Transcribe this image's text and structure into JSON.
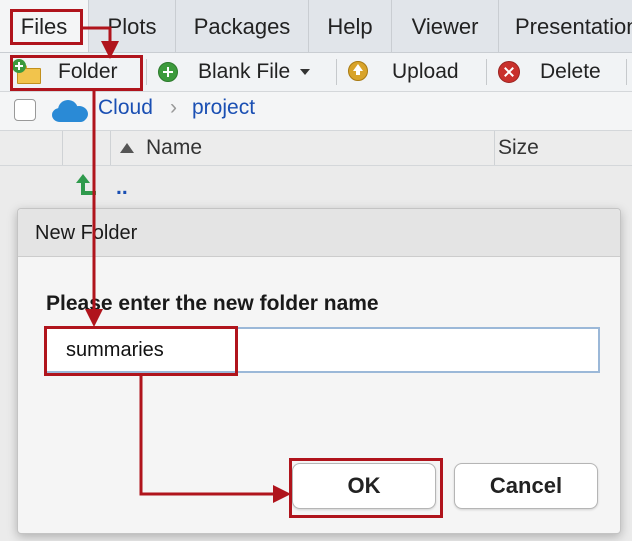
{
  "tabs": [
    {
      "label": "Files",
      "active": true
    },
    {
      "label": "Plots",
      "active": false
    },
    {
      "label": "Packages",
      "active": false
    },
    {
      "label": "Help",
      "active": false
    },
    {
      "label": "Viewer",
      "active": false
    },
    {
      "label": "Presentation",
      "active": false
    }
  ],
  "toolbar": {
    "folder_label": "Folder",
    "blank_file_label": "Blank File",
    "upload_label": "Upload",
    "delete_label": "Delete"
  },
  "breadcrumb": {
    "root": "Cloud",
    "current": "project",
    "separator": "›"
  },
  "columns": {
    "name": "Name",
    "size": "Size"
  },
  "files": {
    "parent_label": ".."
  },
  "dialog": {
    "title": "New Folder",
    "prompt": "Please enter the new folder name",
    "input_value": "summaries",
    "ok_label": "OK",
    "cancel_label": "Cancel"
  },
  "annotation": {
    "color": "#b0141c"
  }
}
